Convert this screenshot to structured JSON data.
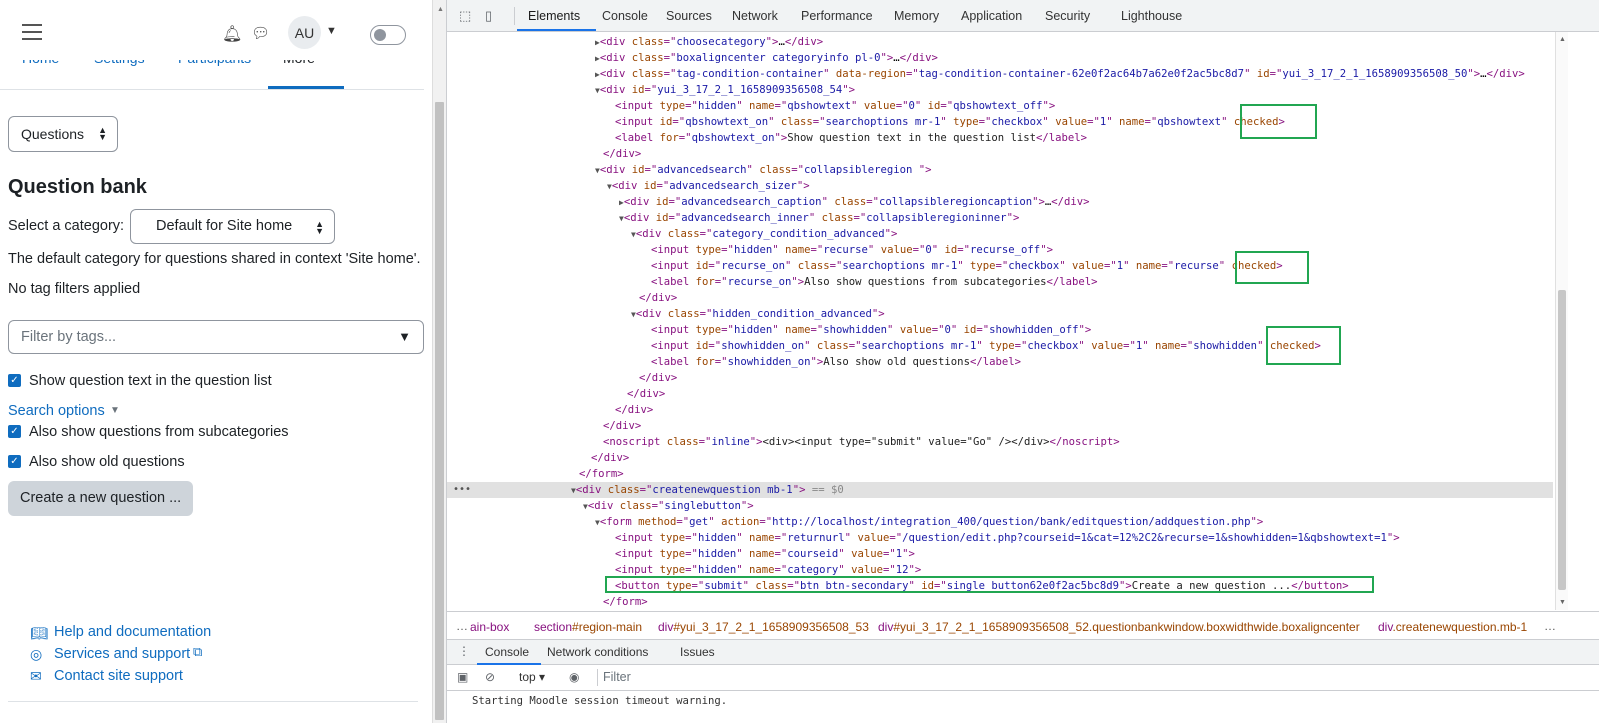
{
  "moodle": {
    "header": {
      "avatar_initials": "AU"
    },
    "tabs": [
      "Home",
      "Settings",
      "Participants",
      "More"
    ],
    "question_select": "Questions",
    "page_title": "Question bank",
    "category_label": "Select a category:",
    "category_value": "Default for Site home",
    "category_info": "The default category for questions shared in context 'Site home'.",
    "tag_info": "No tag filters applied",
    "tag_filter_placeholder": "Filter by tags...",
    "show_text_label": "Show question text in the question list",
    "search_options_label": "Search options",
    "subcat_label": "Also show questions from subcategories",
    "old_label": "Also show old questions",
    "create_button": "Create a new question ...",
    "footer": {
      "help": "Help and documentation",
      "services": "Services and support",
      "contact": "Contact site support"
    }
  },
  "devtools": {
    "tabs": [
      "Elements",
      "Console",
      "Sources",
      "Network",
      "Performance",
      "Memory",
      "Application",
      "Security",
      "Lighthouse"
    ],
    "breadcrumbs": [
      {
        "a": "ain-box",
        "b": ""
      },
      {
        "a": "section",
        "b": "#region-main"
      },
      {
        "a": "div",
        "b": "#yui_3_17_2_1_1658909356508_53"
      },
      {
        "a": "div",
        "b": "#yui_3_17_2_1_1658909356508_52.questionbankwindow.boxwidthwide.boxaligncenter"
      },
      {
        "a": "div",
        "b": ".createnewquestion.mb-1"
      }
    ],
    "drawer_tabs": [
      "Console",
      "Network conditions",
      "Issues"
    ],
    "console_context": "top",
    "console_filter_placeholder": "Filter",
    "console_message": "Starting Moodle session timeout warning."
  }
}
